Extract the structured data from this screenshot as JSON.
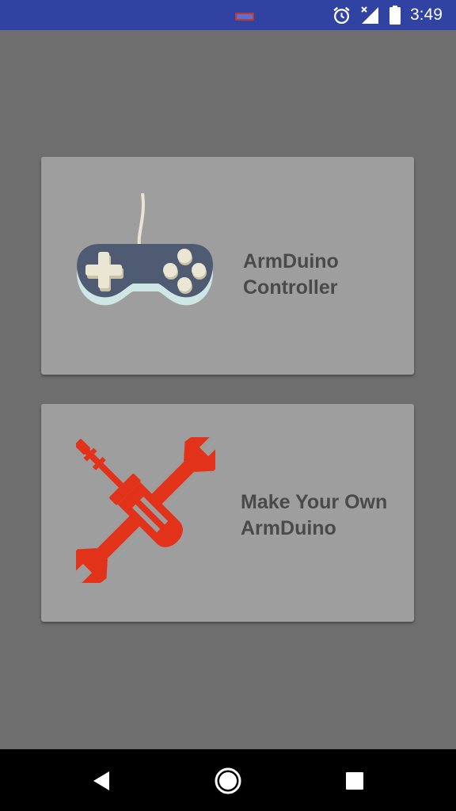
{
  "status_bar": {
    "time": "3:49",
    "background": "#3043a3",
    "icons": [
      "notification-icon",
      "alarm-icon",
      "signal-icon",
      "battery-icon"
    ]
  },
  "cards": [
    {
      "label": "ArmDuino\nController",
      "icon": "gamepad-icon"
    },
    {
      "label": "Make Your Own\nArmDuino",
      "icon": "tools-icon"
    }
  ],
  "nav_bar": {
    "buttons": [
      "back-icon",
      "home-icon",
      "recents-icon"
    ]
  },
  "colors": {
    "background": "#6e6e6e",
    "card": "#9e9e9e",
    "label": "#4a4a4a",
    "tools_red": "#e2331a",
    "gamepad_body": "#4f5a73"
  }
}
